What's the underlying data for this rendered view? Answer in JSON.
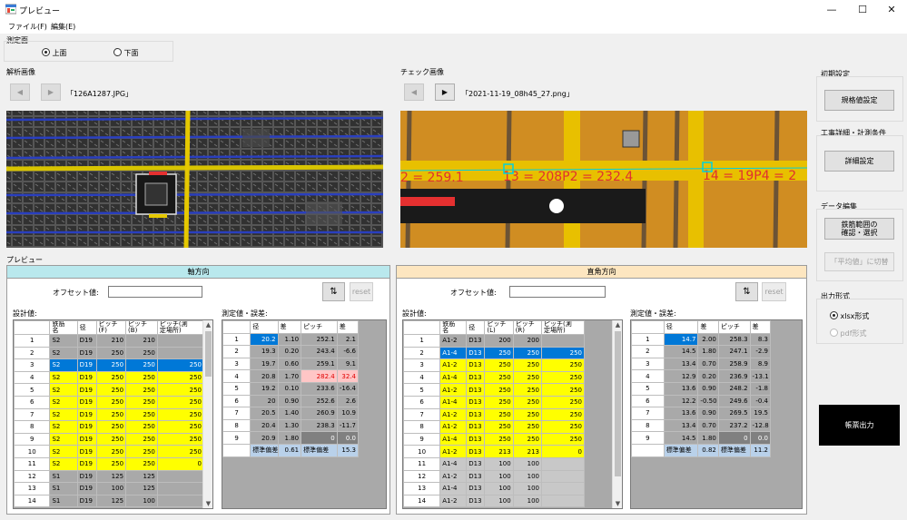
{
  "window": {
    "title": "プレビュー",
    "min": "—",
    "max": "☐",
    "close": "✕"
  },
  "menu": [
    "ファイル(F)",
    "編集(E)"
  ],
  "measure_surface": {
    "title": "測定面",
    "options": [
      "上面",
      "下面"
    ]
  },
  "analysis_image": {
    "title": "解析画像",
    "filename": "「126A1287.JPG」"
  },
  "check_image": {
    "title": "チェック画像",
    "filename": "「2021-11-19_08h45_27.png」",
    "overlay": [
      "2 = 259.1",
      "13 = 208P2 = 232.4",
      "14 = 19P4 = 2"
    ]
  },
  "preview_label": "プレビュー",
  "axis_panel": {
    "title": "軸方向",
    "offset_label": "オフセット値:",
    "offset_value": "",
    "swap_icon": "⇅",
    "reset": "reset",
    "design_label": "設計値:",
    "measured_label": "測定値・誤差:",
    "design_headers": [
      "",
      "鉄筋\n名",
      "径",
      "ピッチ\n(F)",
      "ピッチ\n(B)",
      "ピッチ(測\n定場所)"
    ],
    "design_rows": [
      {
        "n": "1",
        "c": [
          "S2",
          "D19",
          "210",
          "210",
          ""
        ],
        "style": ""
      },
      {
        "n": "2",
        "c": [
          "S2",
          "D19",
          "250",
          "250",
          ""
        ],
        "style": ""
      },
      {
        "n": "3",
        "c": [
          "S2",
          "D19",
          "250",
          "250",
          "250"
        ],
        "style": "blue"
      },
      {
        "n": "4",
        "c": [
          "S2",
          "D19",
          "250",
          "250",
          "250"
        ],
        "style": "yellow"
      },
      {
        "n": "5",
        "c": [
          "S2",
          "D19",
          "250",
          "250",
          "250"
        ],
        "style": "yellow"
      },
      {
        "n": "6",
        "c": [
          "S2",
          "D19",
          "250",
          "250",
          "250"
        ],
        "style": "yellow"
      },
      {
        "n": "7",
        "c": [
          "S2",
          "D19",
          "250",
          "250",
          "250"
        ],
        "style": "yellow"
      },
      {
        "n": "8",
        "c": [
          "S2",
          "D19",
          "250",
          "250",
          "250"
        ],
        "style": "yellow"
      },
      {
        "n": "9",
        "c": [
          "S2",
          "D19",
          "250",
          "250",
          "250"
        ],
        "style": "yellow"
      },
      {
        "n": "10",
        "c": [
          "S2",
          "D19",
          "250",
          "250",
          "250"
        ],
        "style": "yellow"
      },
      {
        "n": "11",
        "c": [
          "S2",
          "D19",
          "250",
          "250",
          "0"
        ],
        "style": "yellow"
      },
      {
        "n": "12",
        "c": [
          "S1",
          "D19",
          "125",
          "125",
          ""
        ],
        "style": ""
      },
      {
        "n": "13",
        "c": [
          "S1",
          "D19",
          "100",
          "125",
          ""
        ],
        "style": ""
      },
      {
        "n": "14",
        "c": [
          "S1",
          "D19",
          "125",
          "100",
          ""
        ],
        "style": ""
      }
    ],
    "measured_headers": [
      "",
      "径",
      "差",
      "ピッチ",
      "差"
    ],
    "measured_rows": [
      {
        "n": "1",
        "c": [
          "20.2",
          "1.10",
          "252.1",
          "2.1"
        ],
        "flags": [
          "sel",
          "",
          "",
          ""
        ]
      },
      {
        "n": "2",
        "c": [
          "19.3",
          "0.20",
          "243.4",
          "-6.6"
        ],
        "flags": [
          "",
          "",
          "",
          ""
        ]
      },
      {
        "n": "3",
        "c": [
          "19.7",
          "0.60",
          "259.1",
          "9.1"
        ],
        "flags": [
          "",
          "",
          "",
          ""
        ]
      },
      {
        "n": "4",
        "c": [
          "20.8",
          "1.70",
          "282.4",
          "32.4"
        ],
        "flags": [
          "",
          "",
          "pink",
          "pink"
        ]
      },
      {
        "n": "5",
        "c": [
          "19.2",
          "0.10",
          "233.6",
          "-16.4"
        ],
        "flags": [
          "",
          "",
          "",
          ""
        ]
      },
      {
        "n": "6",
        "c": [
          "20",
          "0.90",
          "252.6",
          "2.6"
        ],
        "flags": [
          "",
          "",
          "",
          ""
        ]
      },
      {
        "n": "7",
        "c": [
          "20.5",
          "1.40",
          "260.9",
          "10.9"
        ],
        "flags": [
          "",
          "",
          "",
          ""
        ]
      },
      {
        "n": "8",
        "c": [
          "20.4",
          "1.30",
          "238.3",
          "-11.7"
        ],
        "flags": [
          "",
          "",
          "",
          ""
        ]
      },
      {
        "n": "9",
        "c": [
          "20.9",
          "1.80",
          "0",
          "0.0"
        ],
        "flags": [
          "",
          "",
          "dark",
          "dark"
        ]
      }
    ],
    "std_row": [
      "標準偏差",
      "0.61",
      "標準偏差",
      "15.3"
    ]
  },
  "perp_panel": {
    "title": "直角方向",
    "offset_label": "オフセット値:",
    "offset_value": "",
    "swap_icon": "⇅",
    "reset": "reset",
    "design_label": "設計値:",
    "measured_label": "測定値・誤差:",
    "design_headers": [
      "",
      "鉄筋\n名",
      "径",
      "ピッチ\n(L)",
      "ピッチ\n(R)",
      "ピッチ(測\n定場所)"
    ],
    "design_rows": [
      {
        "n": "1",
        "c": [
          "A1-2",
          "D13",
          "200",
          "200",
          ""
        ],
        "style": ""
      },
      {
        "n": "2",
        "c": [
          "A1-4",
          "D13",
          "250",
          "250",
          "250"
        ],
        "style": "blue"
      },
      {
        "n": "3",
        "c": [
          "A1-2",
          "D13",
          "250",
          "250",
          "250"
        ],
        "style": "yellow"
      },
      {
        "n": "4",
        "c": [
          "A1-4",
          "D13",
          "250",
          "250",
          "250"
        ],
        "style": "yellow"
      },
      {
        "n": "5",
        "c": [
          "A1-2",
          "D13",
          "250",
          "250",
          "250"
        ],
        "style": "yellow"
      },
      {
        "n": "6",
        "c": [
          "A1-4",
          "D13",
          "250",
          "250",
          "250"
        ],
        "style": "yellow"
      },
      {
        "n": "7",
        "c": [
          "A1-2",
          "D13",
          "250",
          "250",
          "250"
        ],
        "style": "yellow"
      },
      {
        "n": "8",
        "c": [
          "A1-2",
          "D13",
          "250",
          "250",
          "250"
        ],
        "style": "yellow"
      },
      {
        "n": "9",
        "c": [
          "A1-4",
          "D13",
          "250",
          "250",
          "250"
        ],
        "style": "yellow"
      },
      {
        "n": "10",
        "c": [
          "A1-2",
          "D13",
          "213",
          "213",
          "0"
        ],
        "style": "yellow"
      },
      {
        "n": "11",
        "c": [
          "A1-4",
          "D13",
          "100",
          "100",
          ""
        ],
        "style": "gray"
      },
      {
        "n": "12",
        "c": [
          "A1-2",
          "D13",
          "100",
          "100",
          ""
        ],
        "style": "gray"
      },
      {
        "n": "13",
        "c": [
          "A1-4",
          "D13",
          "100",
          "100",
          ""
        ],
        "style": "gray"
      },
      {
        "n": "14",
        "c": [
          "A1-2",
          "D13",
          "100",
          "100",
          ""
        ],
        "style": "gray"
      }
    ],
    "measured_headers": [
      "",
      "径",
      "差",
      "ピッチ",
      "差"
    ],
    "measured_rows": [
      {
        "n": "1",
        "c": [
          "14.7",
          "2.00",
          "258.3",
          "8.3"
        ],
        "flags": [
          "sel",
          "",
          "",
          ""
        ]
      },
      {
        "n": "2",
        "c": [
          "14.5",
          "1.80",
          "247.1",
          "-2.9"
        ],
        "flags": [
          "",
          "",
          "",
          ""
        ]
      },
      {
        "n": "3",
        "c": [
          "13.4",
          "0.70",
          "258.9",
          "8.9"
        ],
        "flags": [
          "",
          "",
          "",
          ""
        ]
      },
      {
        "n": "4",
        "c": [
          "12.9",
          "0.20",
          "236.9",
          "-13.1"
        ],
        "flags": [
          "",
          "",
          "",
          ""
        ]
      },
      {
        "n": "5",
        "c": [
          "13.6",
          "0.90",
          "248.2",
          "-1.8"
        ],
        "flags": [
          "",
          "",
          "",
          ""
        ]
      },
      {
        "n": "6",
        "c": [
          "12.2",
          "-0.50",
          "249.6",
          "-0.4"
        ],
        "flags": [
          "",
          "",
          "",
          ""
        ]
      },
      {
        "n": "7",
        "c": [
          "13.6",
          "0.90",
          "269.5",
          "19.5"
        ],
        "flags": [
          "",
          "",
          "",
          ""
        ]
      },
      {
        "n": "8",
        "c": [
          "13.4",
          "0.70",
          "237.2",
          "-12.8"
        ],
        "flags": [
          "",
          "",
          "",
          ""
        ]
      },
      {
        "n": "9",
        "c": [
          "14.5",
          "1.80",
          "0",
          "0.0"
        ],
        "flags": [
          "",
          "",
          "dark",
          "dark"
        ]
      }
    ],
    "std_row": [
      "標準偏差",
      "0.82",
      "標準偏差",
      "11.2"
    ]
  },
  "right": {
    "initial_title": "初期設定",
    "spec_button": "規格値設定",
    "work_title": "工事詳細・計測条件",
    "detail_button": "詳細設定",
    "data_title": "データ編集",
    "range_button": "鉄筋範囲の\n確認・選択",
    "avg_button": "「平均値」に切替",
    "output_title": "出力形式",
    "output_options": [
      "xlsx形式",
      "pdf形式"
    ],
    "report_button": "帳票出力"
  },
  "colors": {
    "axis_head": "#b9e8ed",
    "perp_head": "#fde6c0",
    "highlight_yellow": "#ffff00",
    "selection_blue": "#0078d7"
  }
}
